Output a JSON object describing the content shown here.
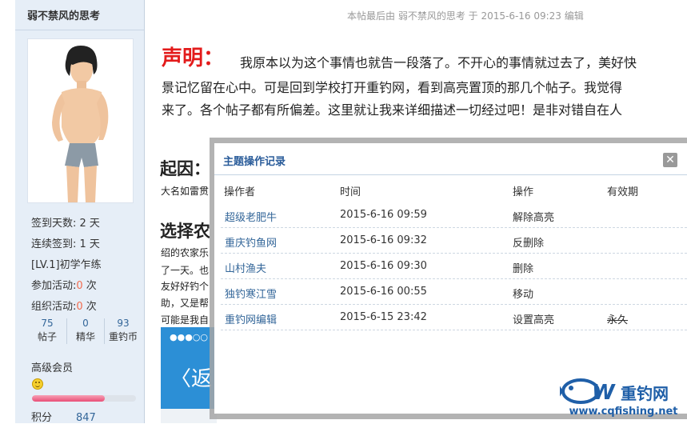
{
  "sidebar": {
    "username": "弱不禁风的思考",
    "sign_days": "签到天数: 2 天",
    "consec_days": "连续签到: 1 天",
    "level": "[LV.1]初学乍练",
    "activities_prefix": "参加活动:",
    "activities_count": "0",
    "activities_suffix": " 次",
    "orgs_prefix": "组织活动:",
    "orgs_count": "0",
    "orgs_suffix": " 次",
    "counts": [
      {
        "num": "75",
        "label": "帖子"
      },
      {
        "num": "0",
        "label": "精华"
      },
      {
        "num": "93",
        "label": "重钓币"
      }
    ],
    "member_level": "高级会员",
    "level_progress": 0.7,
    "points_label": "积分",
    "points_value": "847"
  },
  "post": {
    "edit_note": "本帖最后由 弱不禁风的思考 于 2015-6-16 09:23 编辑",
    "statement_title": "声明：",
    "line1": "我原本以为这个事情也就告一段落了。不开心的事情就过去了，美好快",
    "line2": "景记忆留在心中。可是回到学校打开重钓网，看到高亮置顶的那几个帖子。我觉得",
    "line3": "来了。各个帖子都有所偏差。这里就让我来详细描述一切经过吧！是非对错自在人",
    "cause_heading": "起因：",
    "cause_text": "大名如雷贯",
    "choose_heading": "选择农",
    "para_lines": [
      "绍的农家乐",
      "了一天。也",
      "友好好钓个",
      "助，又是帮",
      "可能是我自"
    ]
  },
  "banner": {
    "dots": "●●●○○",
    "back_glyph": "〈返"
  },
  "modal": {
    "title": "主题操作记录",
    "close_glyph": "✕",
    "columns": [
      "操作者",
      "时间",
      "操作",
      "有效期"
    ],
    "rows": [
      {
        "operator": "超级老肥牛",
        "time": "2015-6-16 09:59",
        "action": "解除高亮",
        "expiry": ""
      },
      {
        "operator": "重庆钓鱼网",
        "time": "2015-6-16 09:32",
        "action": "反删除",
        "expiry": ""
      },
      {
        "operator": "山村渔夫",
        "time": "2015-6-16 09:30",
        "action": "删除",
        "expiry": ""
      },
      {
        "operator": "独钓寒江雪",
        "time": "2015-6-16 00:55",
        "action": "移动",
        "expiry": ""
      },
      {
        "operator": "重钓网编辑",
        "time": "2015-6-15 23:42",
        "action": "设置高亮",
        "expiry": "永久"
      }
    ]
  },
  "watermark": {
    "brand": "重钓网",
    "url": "www.cqfishing.net",
    "color": "#1f5fa8"
  }
}
